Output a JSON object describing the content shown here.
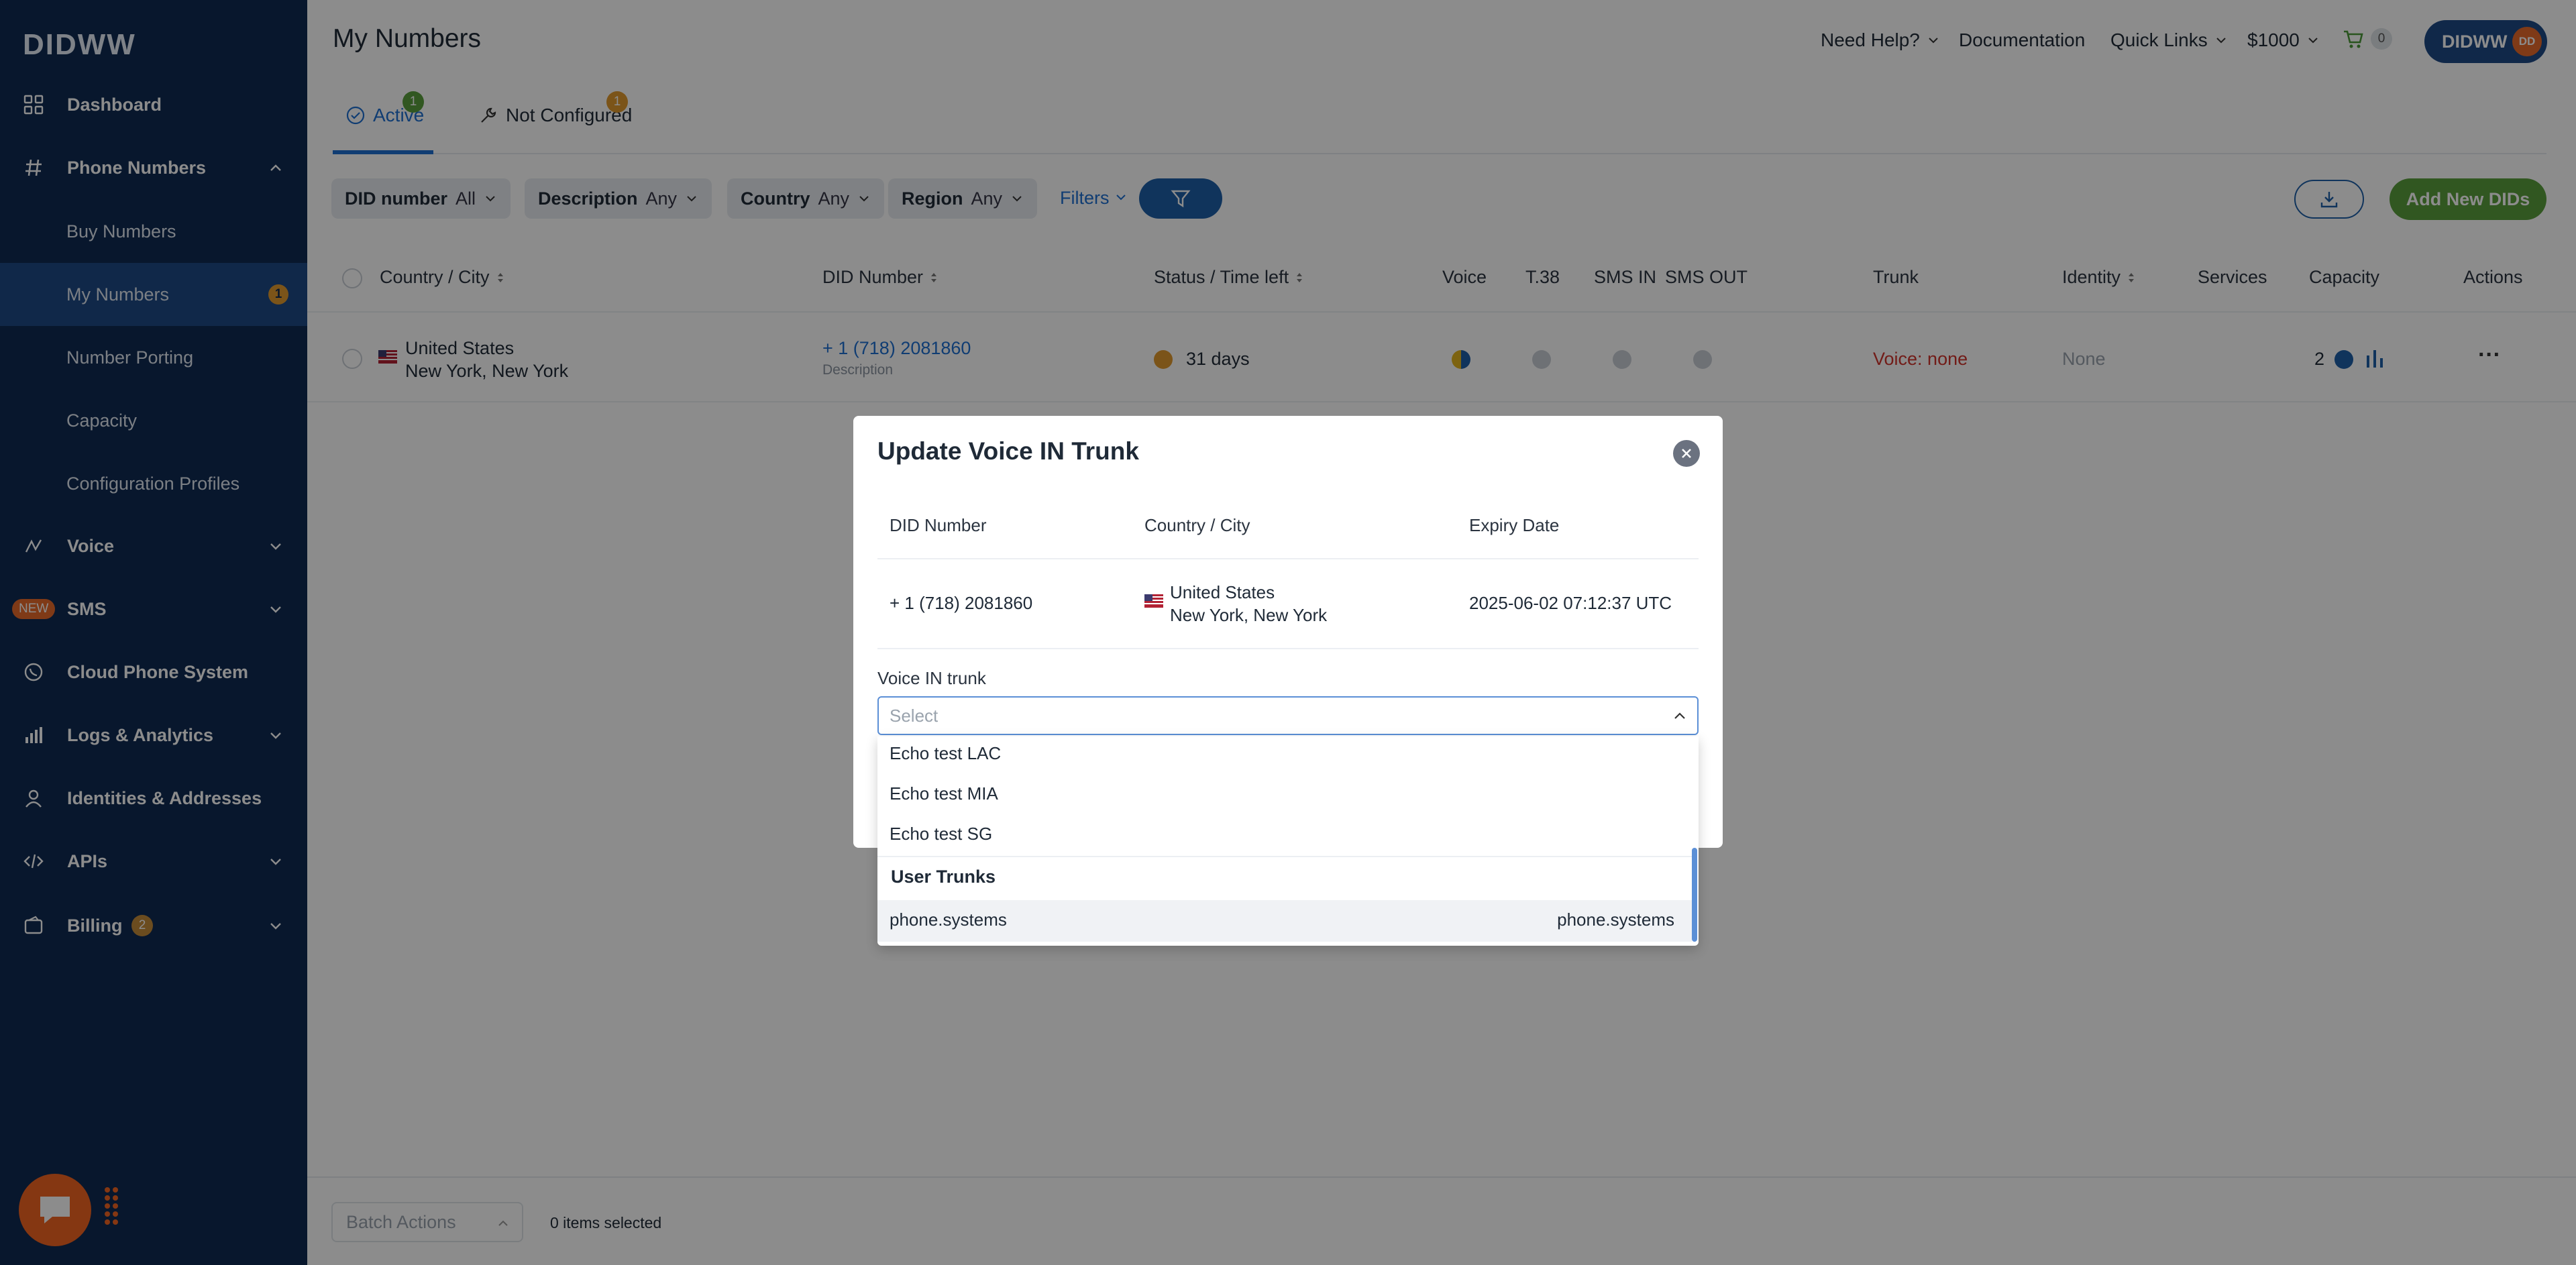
{
  "sidebar": {
    "logo": "DIDWW",
    "items": [
      {
        "label": "Dashboard"
      },
      {
        "label": "Phone Numbers"
      },
      {
        "label": "Voice"
      },
      {
        "label": "SMS",
        "tag": "NEW"
      },
      {
        "label": "Cloud Phone System"
      },
      {
        "label": "Logs & Analytics"
      },
      {
        "label": "Identities & Addresses"
      },
      {
        "label": "APIs"
      },
      {
        "label": "Billing",
        "badge": "2"
      }
    ],
    "sub_items": [
      {
        "label": "Buy Numbers"
      },
      {
        "label": "My Numbers",
        "badge": "1"
      },
      {
        "label": "Number Porting"
      },
      {
        "label": "Capacity"
      },
      {
        "label": "Configuration Profiles"
      }
    ]
  },
  "header": {
    "title": "My Numbers",
    "need_help": "Need Help?",
    "documentation": "Documentation",
    "quick_links": "Quick Links",
    "balance": "$1000",
    "cart_count": "0",
    "account": "DIDWW",
    "avatar": "DD"
  },
  "tabs": [
    {
      "label": "Active",
      "badge": "1"
    },
    {
      "label": "Not Configured",
      "badge": "1"
    }
  ],
  "filters": {
    "did_number": {
      "label": "DID number",
      "value": "All"
    },
    "description": {
      "label": "Description",
      "value": "Any"
    },
    "country": {
      "label": "Country",
      "value": "Any"
    },
    "region": {
      "label": "Region",
      "value": "Any"
    },
    "filters_link": "Filters",
    "add_button": "Add New DIDs"
  },
  "table": {
    "columns": [
      "Country / City",
      "DID Number",
      "Status / Time left",
      "Voice",
      "T.38",
      "SMS IN",
      "SMS OUT",
      "Trunk",
      "Identity",
      "Services",
      "Capacity",
      "Actions"
    ],
    "row": {
      "country": "United States",
      "city": "New York, New York",
      "did": "+ 1 (718) 2081860",
      "description": "Description",
      "status": "31 days",
      "trunk": "Voice: none",
      "identity": "None",
      "capacity": "2",
      "actions": "···"
    }
  },
  "bottom": {
    "batch_actions": "Batch Actions",
    "items_selected": "0 items selected"
  },
  "modal": {
    "title": "Update Voice IN Trunk",
    "columns": [
      "DID Number",
      "Country / City",
      "Expiry Date"
    ],
    "did": "+ 1 (718) 2081860",
    "country": "United States",
    "city": "New York, New York",
    "expiry": "2025-06-02 07:12:37 UTC",
    "field_label": "Voice IN trunk",
    "select_placeholder": "Select"
  },
  "dropdown": {
    "options": [
      "Echo test LAC",
      "Echo test MIA",
      "Echo test SG"
    ],
    "group": "User Trunks",
    "user_trunk": {
      "name": "phone.systems",
      "right": "phone.systems"
    }
  },
  "colors": {
    "sidebar": "#0f2a52",
    "accent": "#1e6fd1",
    "green": "#5a9e3c",
    "orange": "#f26522",
    "status_orange": "#e19a2e",
    "trunk_red": "#d0342c"
  }
}
